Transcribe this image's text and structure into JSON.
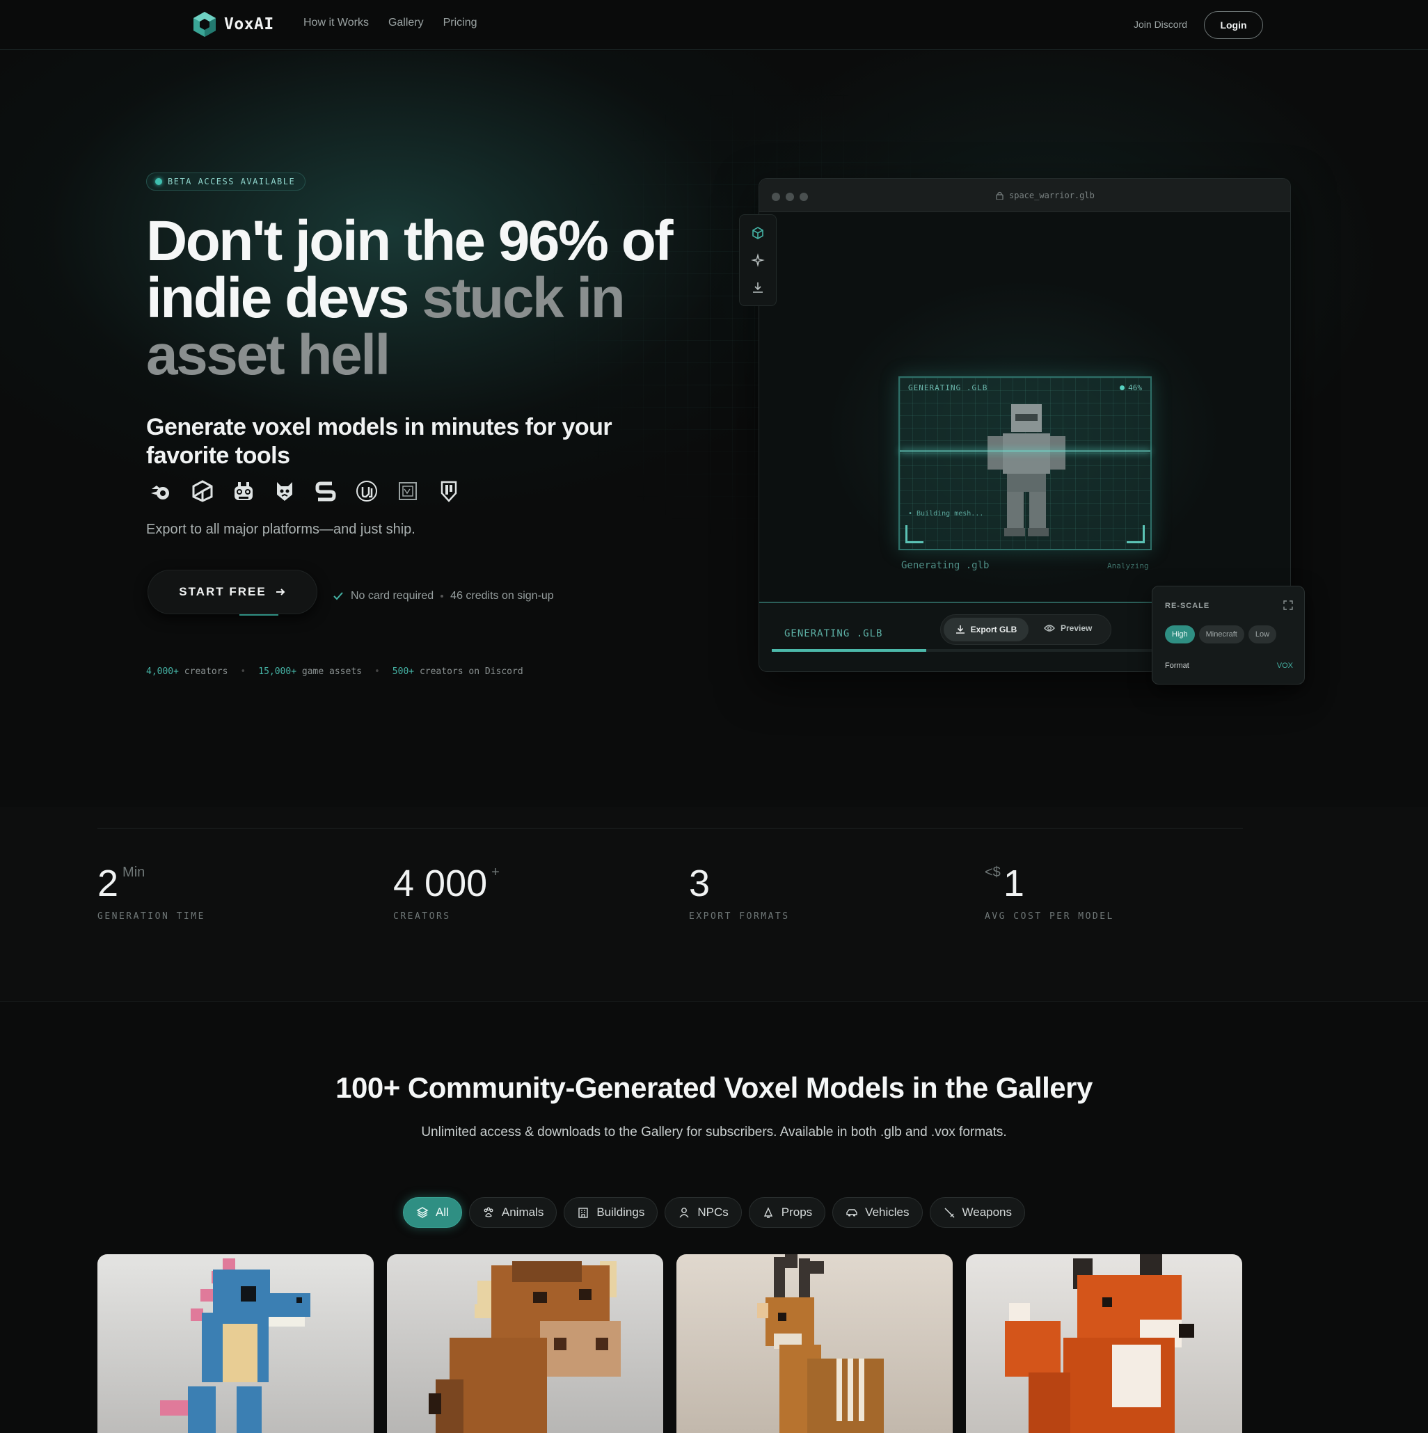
{
  "nav": {
    "logo_text": "VoxAI",
    "links": [
      "How it Works",
      "Gallery",
      "Pricing"
    ],
    "discord": "Join Discord",
    "login": "Login"
  },
  "hero": {
    "badge": "BETA ACCESS AVAILABLE",
    "title_part1": "Don't join the 96% of indie devs",
    "title_part2": "stuck in asset hell",
    "subtitle": "Generate voxel models in minutes for your favorite tools",
    "tools": [
      "blender-icon",
      "unity-icon",
      "godot-icon",
      "gamemaker-icon",
      "s-box-icon",
      "unreal-icon",
      "roblox-icon",
      "defold-icon"
    ],
    "export_text": "Export to all major platforms—and just ship.",
    "cta": "START FREE",
    "check1": "No card required",
    "check2": "46 credits on sign-up",
    "stat1_num": "4,000+",
    "stat1_text": "creators",
    "stat2_num": "15,000+",
    "stat2_text": "game assets",
    "stat3_num": "500+",
    "stat3_text": "creators on Discord"
  },
  "editor": {
    "filename": "space_warrior.glb",
    "frame_title": "GENERATING .GLB",
    "percent": "46%",
    "progress": 0.3,
    "building": "• Building mesh...",
    "generating_label": "Generating .glb",
    "analyzing": "Analyzing",
    "footer_status": "GENERATING .GLB",
    "export_btn": "Export GLB",
    "preview_btn": "Preview"
  },
  "rescale": {
    "title": "RE-SCALE",
    "options": [
      "High",
      "Minecraft",
      "Low"
    ],
    "selected": "High",
    "format_label": "Format",
    "format_value": "VOX"
  },
  "metrics": [
    {
      "value": "2",
      "sup": "Min",
      "pre": "",
      "label": "GENERATION TIME"
    },
    {
      "value": "4 000",
      "sup": "+",
      "pre": "",
      "label": "CREATORS"
    },
    {
      "value": "3",
      "sup": "",
      "pre": "",
      "label": "EXPORT FORMATS"
    },
    {
      "value": "1",
      "sup": "",
      "pre": "<$",
      "label": "AVG COST PER MODEL"
    }
  ],
  "gallery": {
    "title": "100+ Community-Generated Voxel Models in the Gallery",
    "subtitle": "Unlimited access & downloads to the Gallery for subscribers. Available in both .glb and .vox formats.",
    "filters": [
      "All",
      "Animals",
      "Buildings",
      "NPCs",
      "Props",
      "Vehicles",
      "Weapons"
    ],
    "active_filter": "All"
  },
  "colors": {
    "accent": "#2f8f83",
    "accent_light": "#45b3a5",
    "background": "#0b0c0c"
  }
}
